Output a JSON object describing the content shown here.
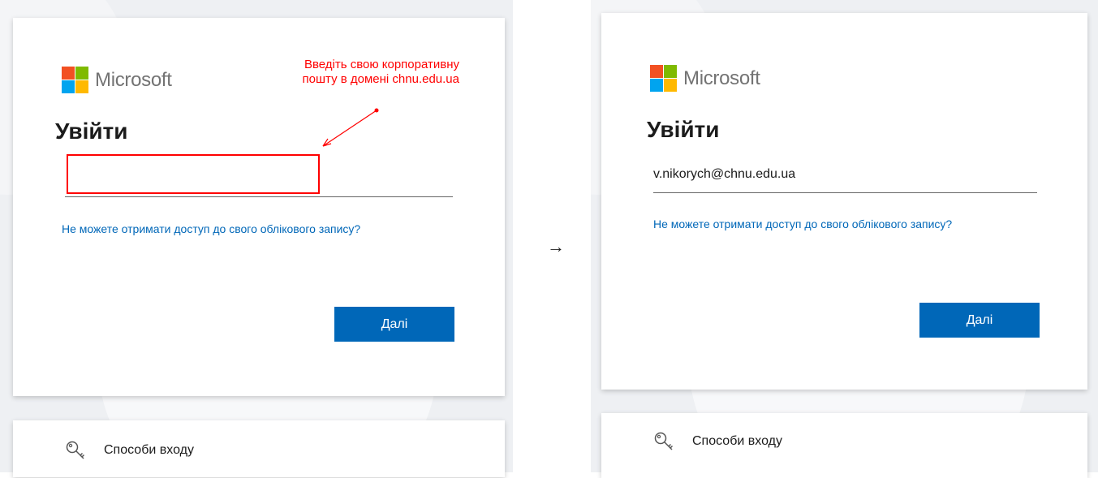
{
  "left": {
    "brand": "Microsoft",
    "title": "Увійти",
    "email_value": "",
    "help_link": "Не можете отримати доступ до свого облікового запису?",
    "next_button": "Далі",
    "signin_options": "Способи входу",
    "annotation": {
      "line1": "Введіть свою корпоративну",
      "line2": "пошту в домені chnu.edu.ua",
      "color": "#ff0000"
    }
  },
  "separator": "→",
  "right": {
    "brand": "Microsoft",
    "title": "Увійти",
    "email_value": "v.nikorych@chnu.edu.ua",
    "help_link": "Не можете отримати доступ до свого облікового запису?",
    "next_button": "Далі",
    "signin_options": "Способи входу"
  },
  "colors": {
    "accent": "#0067b8",
    "logo_red": "#f25022",
    "logo_green": "#7fba00",
    "logo_blue": "#00a4ef",
    "logo_yellow": "#ffb900"
  },
  "icons": [
    "microsoft-logo-icon",
    "key-icon",
    "arrow-right-icon",
    "annotation-arrow-icon"
  ]
}
